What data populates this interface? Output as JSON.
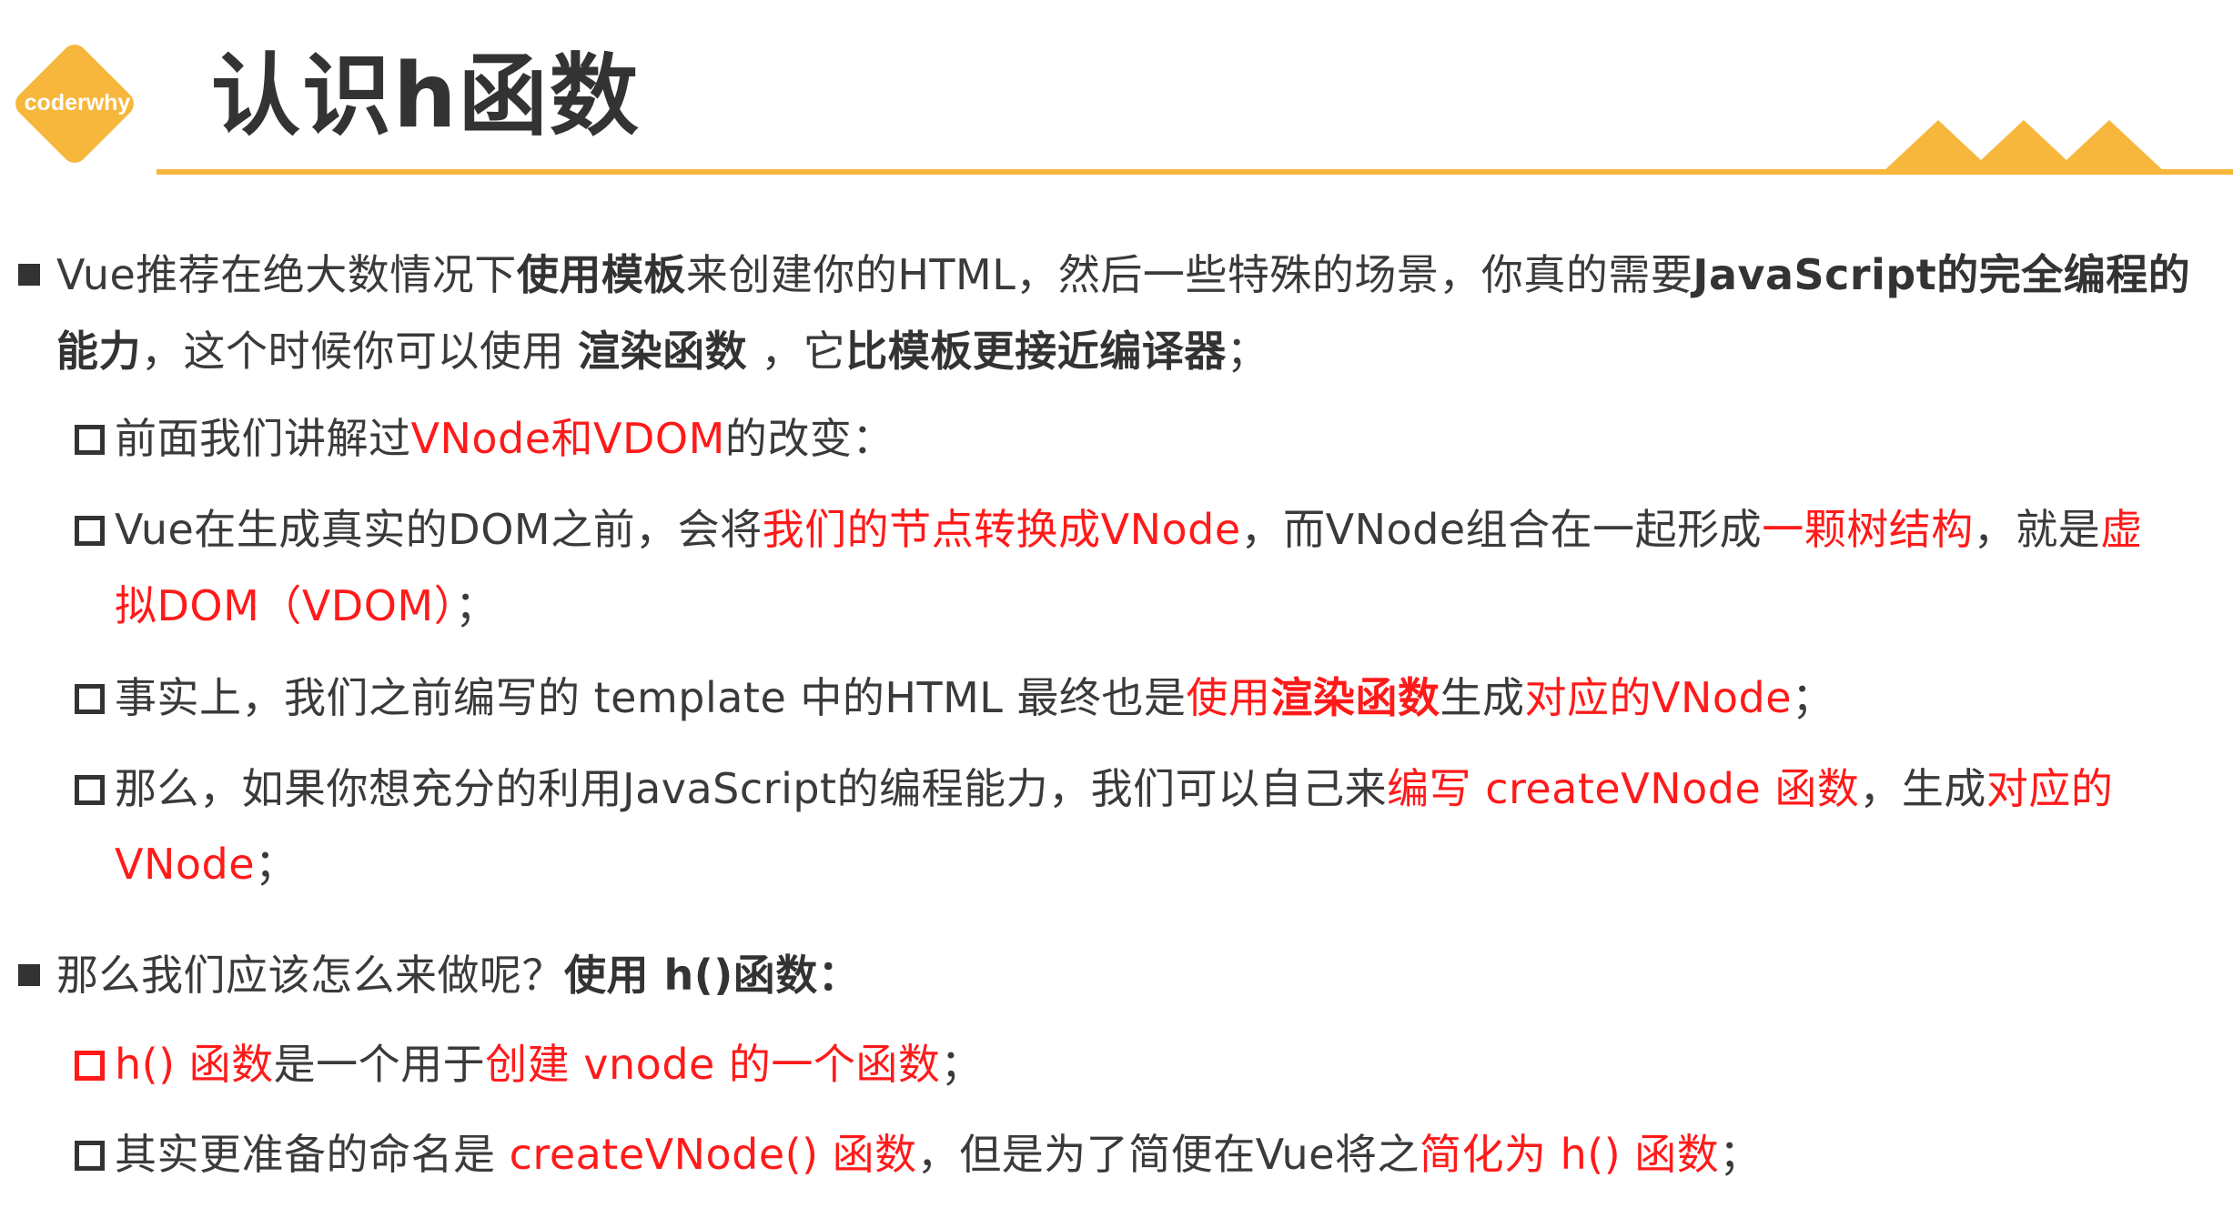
{
  "logo": {
    "text": "coderwhy",
    "color": "#f6b73c"
  },
  "title": "认识h函数",
  "colors": {
    "accent": "#f6b73c",
    "highlight": "#ff1a1a",
    "text": "#3a3a3a"
  },
  "p1": {
    "a": "Vue推荐在绝大数情况下",
    "b": "使用模板",
    "c": "来创建你的HTML，然后一些特殊的场景，你真的需要",
    "d": "JavaScript的完全编程的",
    "e": "能力",
    "f": "，这个时候你可以使用 ",
    "g": "渲染函数",
    "h": " ，它",
    "i": "比模板更接近编译器",
    "j": "；"
  },
  "s1": {
    "a": "前面我们讲解过",
    "b": "VNode和VDOM",
    "c": "的改变："
  },
  "s2": {
    "a": "Vue在生成真实的DOM之前，会将",
    "b": "我们的节点转换成VNode",
    "c": "，而VNode组合在一起形成",
    "d": "一颗树结构",
    "e": "，就是",
    "f": "虚",
    "g": "拟DOM（VDOM）",
    "h": "；"
  },
  "s3": {
    "a": "事实上，我们之前编写的 template 中的HTML 最终也是",
    "b": "使用",
    "c": "渲染函数",
    "d": "生成",
    "e": "对应的VNode",
    "f": "；"
  },
  "s4": {
    "a": "那么，如果你想充分的利用JavaScript的编程能力，我们可以自己来",
    "b": "编写 createVNode 函数",
    "c": "，生成",
    "d": "对应的",
    "e": "VNode",
    "f": "；"
  },
  "p2": {
    "a": "那么我们应该怎么来做呢？",
    "b": "使用 h()函数："
  },
  "s5": {
    "a": "h() 函数",
    "b": "是一个用于",
    "c": "创建 vnode 的一个函数",
    "d": "；"
  },
  "s6": {
    "a": "其实更准备的命名是 ",
    "b": "createVNode() 函数",
    "c": "，但是为了简便在Vue将之",
    "d": "简化为 h() 函数",
    "e": "；"
  }
}
